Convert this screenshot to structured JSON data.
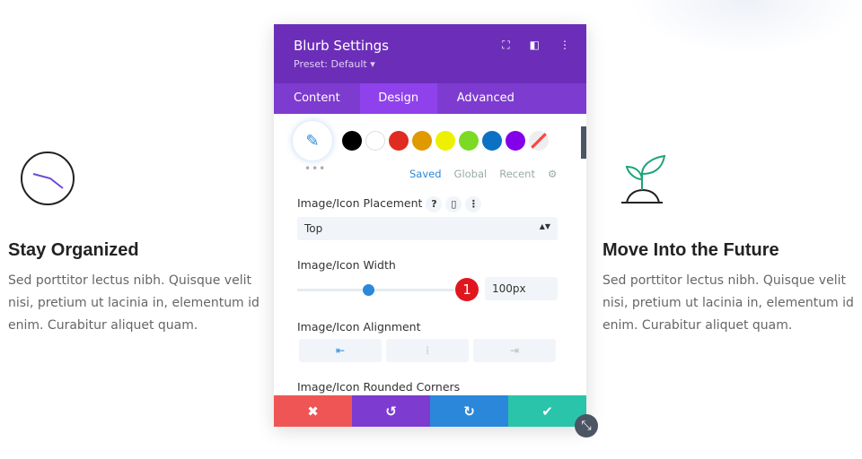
{
  "left": {
    "title": "Stay Organized",
    "text": "Sed porttitor lectus nibh. Quisque velit nisi, pretium ut lacinia in, elementum id enim. Curabitur aliquet quam."
  },
  "right": {
    "title": "Move Into the Future",
    "text": "Sed porttitor lectus nibh. Quisque velit nisi, pretium ut lacinia in, elementum id enim. Curabitur aliquet quam."
  },
  "panel": {
    "title": "Blurb Settings",
    "preset": "Preset: Default ▾",
    "tabs": [
      "Content",
      "Design",
      "Advanced"
    ],
    "swatches": [
      "#000000",
      "#ffffff",
      "#e02b20",
      "#e09900",
      "#edf000",
      "#7cda24",
      "#0c71c3",
      "#8300e9"
    ],
    "color_tabs": [
      "Saved",
      "Global",
      "Recent"
    ],
    "placement_label": "Image/Icon Placement",
    "placement_value": "Top",
    "width_label": "Image/Icon Width",
    "width_value": "100px",
    "slider_fraction": 0.45,
    "badge": "1",
    "alignment_label": "Image/Icon Alignment",
    "alignment_selected": "left",
    "corners_label": "Image/Icon Rounded Corners"
  },
  "colors": {
    "header": "#6c2eb9",
    "tabs": "#7e3bd0",
    "cancel": "#ef5555",
    "undo": "#7e3bd0",
    "redo": "#2b87da",
    "save": "#29c4a9"
  }
}
